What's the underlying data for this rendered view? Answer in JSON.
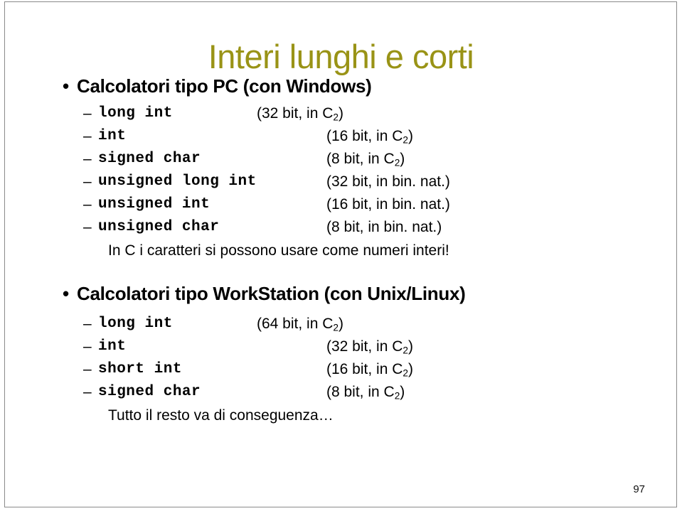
{
  "slide": {
    "title": "Interi lunghi e corti",
    "page_number": "97",
    "title_color": "#999316",
    "text_color": "#000000",
    "background_color": "#ffffff"
  },
  "sections": [
    {
      "bullet_glyph": "•",
      "heading": "Calcolatori tipo PC (con Windows)",
      "dash_glyph": "–",
      "items": [
        {
          "code": "long int",
          "size": "32",
          "unit": "bit",
          "rep": "C",
          "rep_sub": "2",
          "desc": "(32 bit, in C",
          "desc_tail": ")",
          "column": "a"
        },
        {
          "code": "int",
          "size": "16",
          "unit": "bit",
          "rep": "C",
          "rep_sub": "2",
          "desc": "(16 bit, in C",
          "desc_tail": ")",
          "column": "b"
        },
        {
          "code": "signed char",
          "size": "8",
          "unit": "bit",
          "rep": "C",
          "rep_sub": "2",
          "desc": "(8 bit, in C",
          "desc_tail": ")",
          "column": "b"
        },
        {
          "code": "unsigned long int",
          "size": "32",
          "unit": "bit",
          "rep": "bin. nat.",
          "rep_sub": "",
          "desc": "(32 bit, in bin. nat.)",
          "desc_tail": "",
          "column": "b"
        },
        {
          "code": "unsigned int",
          "size": "16",
          "unit": "bit",
          "rep": "bin. nat.",
          "rep_sub": "",
          "desc": "(16 bit, in bin. nat.)",
          "desc_tail": "",
          "column": "b"
        },
        {
          "code": "unsigned char",
          "size": "8",
          "unit": "bit",
          "rep": "bin. nat.",
          "rep_sub": "",
          "desc": "(8 bit, in bin. nat.)",
          "desc_tail": "",
          "column": "b"
        }
      ],
      "note": "In C i caratteri si possono usare come numeri interi!"
    },
    {
      "bullet_glyph": "•",
      "heading": "Calcolatori tipo WorkStation (con Unix/Linux)",
      "dash_glyph": "–",
      "items": [
        {
          "code": "long int",
          "size": "64",
          "unit": "bit",
          "rep": "C",
          "rep_sub": "2",
          "desc": "(64 bit, in C",
          "desc_tail": ")",
          "column": "a"
        },
        {
          "code": "int",
          "size": "32",
          "unit": "bit",
          "rep": "C",
          "rep_sub": "2",
          "desc": "(32 bit, in C",
          "desc_tail": ")",
          "column": "b"
        },
        {
          "code": "short int",
          "size": "16",
          "unit": "bit",
          "rep": "C",
          "rep_sub": "2",
          "desc": "(16 bit, in C",
          "desc_tail": ")",
          "column": "b"
        },
        {
          "code": "signed char",
          "size": "8",
          "unit": "bit",
          "rep": "C",
          "rep_sub": "2",
          "desc": "(8 bit, in C",
          "desc_tail": ")",
          "column": "b"
        }
      ],
      "note": "Tutto il resto va di conseguenza…"
    }
  ]
}
